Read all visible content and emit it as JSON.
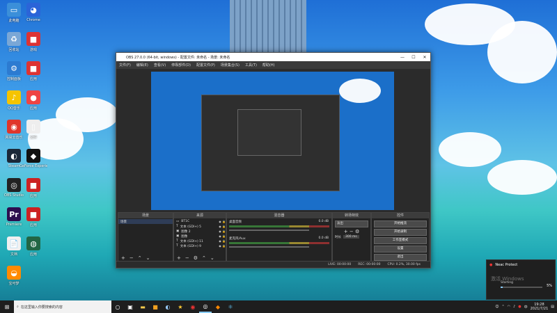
{
  "desktop": {
    "icons": [
      {
        "label": "此电脑",
        "color": "#3b8fd9",
        "glyph": "▭"
      },
      {
        "label": "回收站",
        "color": "#7aa7d6",
        "glyph": "♻"
      },
      {
        "label": "控制面板",
        "color": "#2c7bd1",
        "glyph": "⚙"
      },
      {
        "label": "QQ音乐",
        "color": "#f5c400",
        "glyph": "♪"
      },
      {
        "label": "网易云音乐",
        "color": "#e0352b",
        "glyph": "◉"
      },
      {
        "label": "Steam",
        "color": "#1b2838",
        "glyph": "◐"
      },
      {
        "label": "OBS Studio",
        "color": "#222222",
        "glyph": "◎"
      },
      {
        "label": "Premiere",
        "color": "#2d0f4f",
        "glyph": "Pr"
      },
      {
        "label": "文档",
        "color": "#f0f0f0",
        "glyph": "📄"
      },
      {
        "label": "宝可梦",
        "color": "#ff8a00",
        "glyph": "◒"
      }
    ],
    "icons_col2": [
      {
        "label": "Chrome",
        "color": "#2b64d8",
        "glyph": "◕"
      },
      {
        "label": "游戏",
        "color": "#d33",
        "glyph": "■"
      },
      {
        "label": "应用",
        "color": "#d33",
        "glyph": "■"
      },
      {
        "label": "应用",
        "color": "#e44",
        "glyph": "●"
      },
      {
        "label": "文件",
        "color": "#eee",
        "glyph": "▯"
      },
      {
        "label": "GeForce Experience",
        "color": "#111",
        "glyph": "◆"
      },
      {
        "label": "应用",
        "color": "#c22",
        "glyph": "■"
      },
      {
        "label": "应用",
        "color": "#c22",
        "glyph": "■"
      },
      {
        "label": "应用",
        "color": "#264",
        "glyph": "◍"
      }
    ]
  },
  "obs": {
    "title": "OBS 27.0.0 (64-bit, windows) - 配置文件: 未命名 - 场景: 未命名",
    "menu": [
      "文件(F)",
      "编辑(E)",
      "查看(V)",
      "停靠部件(D)",
      "配置文件(P)",
      "场景集合(S)",
      "工具(T)",
      "帮助(H)"
    ],
    "docks": {
      "scenes": {
        "title": "场景",
        "items": [
          "场景"
        ]
      },
      "sources": {
        "title": "来源",
        "items": [
          "BT1C",
          "文本 (GDI+) 5",
          "图像 2",
          "图像",
          "文本 (GDI+) 11",
          "文本 (GDI+) 9"
        ]
      },
      "mixer": {
        "title": "混音器",
        "tracks": [
          {
            "name": "桌面音频",
            "db": "0.0 dB"
          },
          {
            "name": "麦克风/Aux",
            "db": "0.0 dB"
          }
        ]
      },
      "transitions": {
        "title": "转场特效",
        "type": "淡出",
        "duration_label": "时长",
        "duration": "300 ms"
      },
      "controls": {
        "title": "控件",
        "buttons": [
          "开始推流",
          "开始录制",
          "工作室模式",
          "设置",
          "退出"
        ]
      }
    },
    "status": {
      "live": "LIVE: 00:00:00",
      "rec": "REC: 00:00:00",
      "cpu": "CPU: 0.2%, 30.00 fps"
    }
  },
  "notification": {
    "app": "Neac Protect",
    "text": "Starting",
    "percent": "5%",
    "watermark": "激活 Windows"
  },
  "taskbar": {
    "search_placeholder": "在这里输入你要搜索的内容",
    "time": "19:28",
    "date": "2021/7/21"
  }
}
